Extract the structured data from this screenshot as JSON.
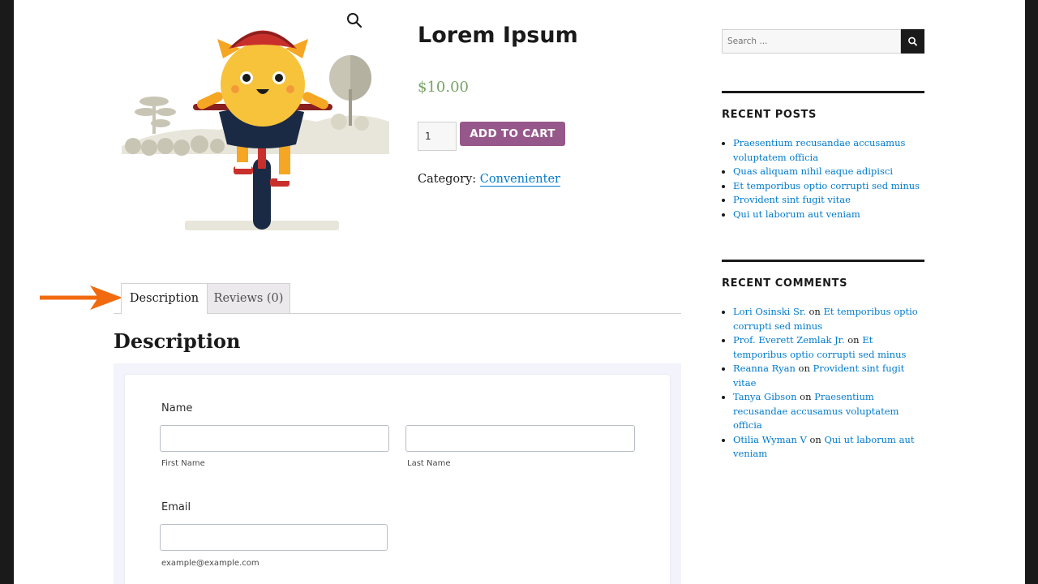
{
  "product": {
    "title": "Lorem Ipsum",
    "price": "$10.00",
    "quantity": "1",
    "add_to_cart": "ADD TO CART",
    "category_label": "Category: ",
    "category": "Convenienter"
  },
  "tabs": [
    {
      "label": "Description"
    },
    {
      "label": "Reviews (0)"
    }
  ],
  "description_heading": "Description",
  "form": {
    "name_label": "Name",
    "first_name_sub": "First Name",
    "last_name_sub": "Last Name",
    "email_label": "Email",
    "email_sub": "example@example.com"
  },
  "sidebar": {
    "search_placeholder": "Search ...",
    "recent_posts_title": "RECENT POSTS",
    "recent_posts": [
      "Praesentium recusandae accusamus voluptatem officia",
      "Quas aliquam nihil eaque adipisci",
      "Et temporibus optio corrupti sed minus",
      "Provident sint fugit vitae",
      "Qui ut laborum aut veniam"
    ],
    "recent_comments_title": "RECENT COMMENTS",
    "on_word": "on",
    "recent_comments": [
      {
        "author": "Lori Osinski Sr.",
        "post": "Et temporibus optio corrupti sed minus"
      },
      {
        "author": "Prof. Everett Zemlak Jr.",
        "post": "Et temporibus optio corrupti sed minus"
      },
      {
        "author": "Reanna Ryan",
        "post": "Provident sint fugit vitae"
      },
      {
        "author": "Tanya Gibson",
        "post": "Praesentium recusandae accusamus voluptatem officia"
      },
      {
        "author": "Otilia Wyman V",
        "post": "Qui ut laborum aut veniam"
      }
    ]
  },
  "colors": {
    "accent_purple": "#96588a",
    "price_green": "#77a464",
    "link_blue": "#007acc",
    "arrow_orange": "#f26a10"
  }
}
